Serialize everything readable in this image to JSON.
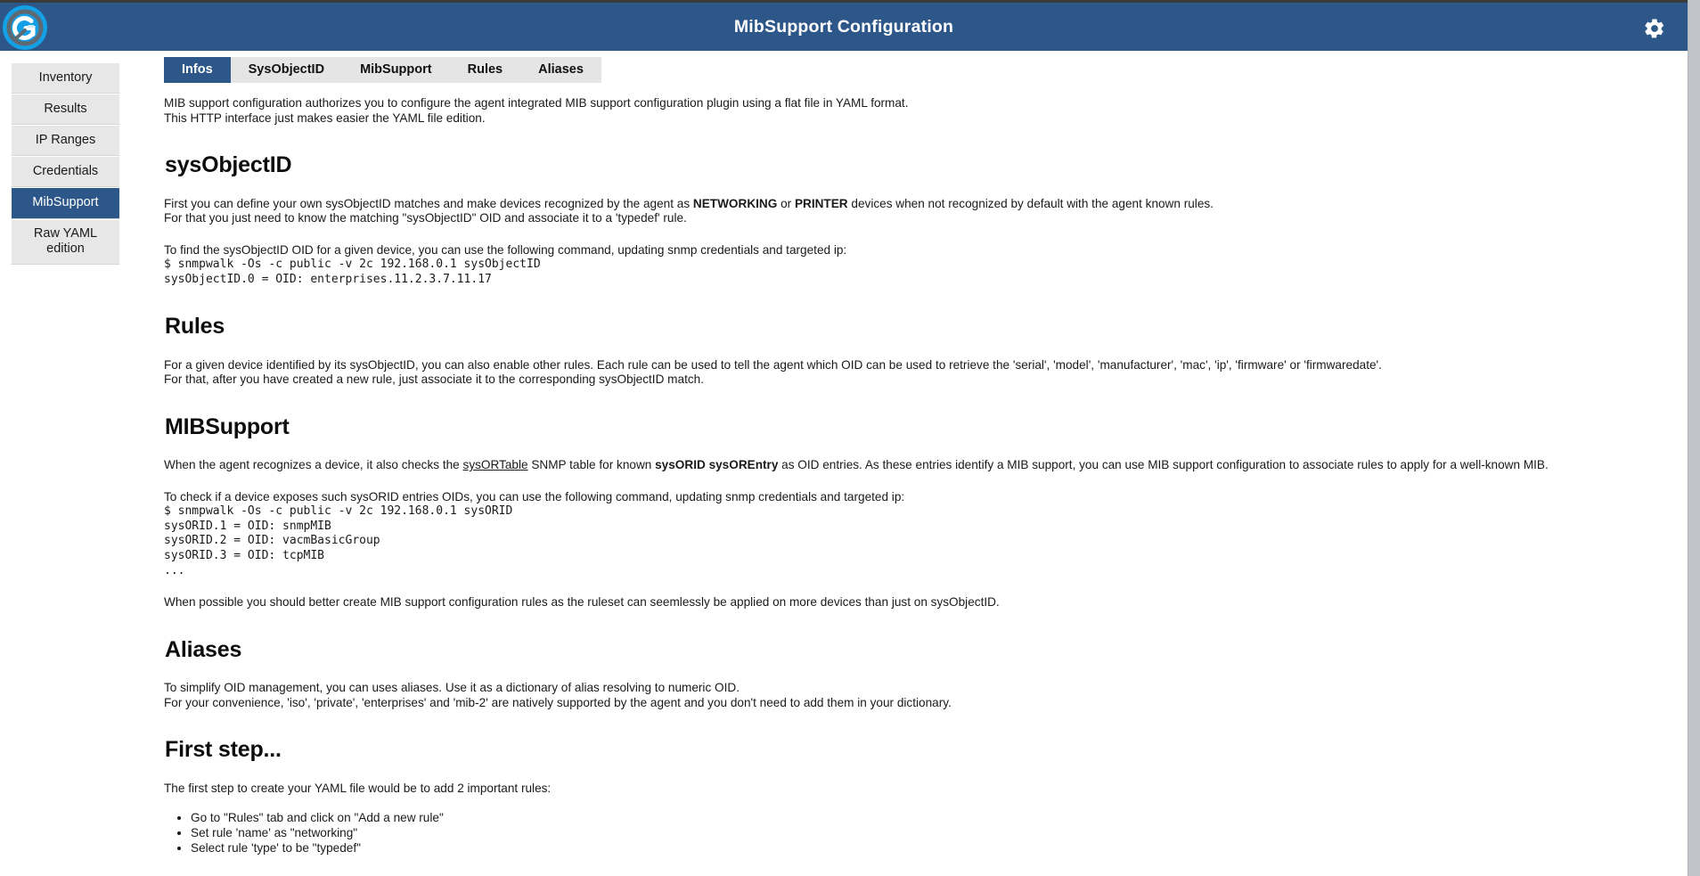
{
  "window": {
    "title": "MibSupport Configuration",
    "logo_icon": "glpi-agent-logo-icon",
    "settings_icon": "gear-icon",
    "header_bg": "#2e5789",
    "accent": "#2e5789"
  },
  "sidebar": {
    "items": [
      {
        "label": "Inventory",
        "active": false
      },
      {
        "label": "Results",
        "active": false
      },
      {
        "label": "IP Ranges",
        "active": false
      },
      {
        "label": "Credentials",
        "active": false
      },
      {
        "label": "MibSupport",
        "active": true
      },
      {
        "label": "Raw YAML edition",
        "active": false
      }
    ]
  },
  "tabs": [
    {
      "label": "Infos",
      "active": true
    },
    {
      "label": "SysObjectID",
      "active": false
    },
    {
      "label": "MibSupport",
      "active": false
    },
    {
      "label": "Rules",
      "active": false
    },
    {
      "label": "Aliases",
      "active": false
    }
  ],
  "main": {
    "intro_line1": "MIB support configuration authorizes you to configure the agent integrated MIB support configuration plugin using a flat file in YAML format.",
    "intro_line2": "This HTTP interface just makes easier the YAML file edition.",
    "sysobjectid": {
      "heading": "sysObjectID",
      "p1_a": "First you can define your own sysObjectID matches and make devices recognized by the agent as ",
      "p1_b1": "NETWORKING",
      "p1_mid": " or ",
      "p1_b2": "PRINTER",
      "p1_c": " devices when not recognized by default with the agent known rules.",
      "p2": "For that you just need to know the matching \"sysObjectID\" OID and associate it to a 'typedef' rule.",
      "cmd_intro": "To find the sysObjectID OID for a given device, you can use the following command, updating snmp credentials and targeted ip:",
      "cmd_line1": "$ snmpwalk -Os -c public -v 2c 192.168.0.1 sysObjectID",
      "cmd_line2": "sysObjectID.0 = OID: enterprises.11.2.3.7.11.17"
    },
    "rules": {
      "heading": "Rules",
      "p1": "For a given device identified by its sysObjectID, you can also enable other rules. Each rule can be used to tell the agent which OID can be used to retrieve the 'serial', 'model', 'manufacturer', 'mac', 'ip', 'firmware' or 'firmwaredate'.",
      "p2": "For that, after you have created a new rule, just associate it to the corresponding sysObjectID match."
    },
    "mibsupport": {
      "heading": "MIBSupport",
      "p1_a": "When the agent recognizes a device, it also checks the ",
      "p1_link": "sysORTable",
      "p1_b": " SNMP table for known ",
      "p1_bold": "sysORID sysOREntry",
      "p1_c": " as OID entries. As these entries identify a MIB support, you can use MIB support configuration to associate rules to apply for a well-known MIB.",
      "cmd_intro": "To check if a device exposes such sysORID entries OIDs, you can use the following command, updating snmp credentials and targeted ip:",
      "cmd_line1": "$ snmpwalk -Os -c public -v 2c 192.168.0.1 sysORID",
      "cmd_line2": "sysORID.1 = OID: snmpMIB",
      "cmd_line3": "sysORID.2 = OID: vacmBasicGroup",
      "cmd_line4": "sysORID.3 = OID: tcpMIB",
      "cmd_line5": "...",
      "p_after": "When possible you should better create MIB support configuration rules as the ruleset can seemlessly be applied on more devices than just on sysObjectID."
    },
    "aliases": {
      "heading": "Aliases",
      "p1": "To simplify OID management, you can uses aliases. Use it as a dictionary of alias resolving to numeric OID.",
      "p2": "For your convenience, 'iso', 'private', 'enterprises' and 'mib-2' are natively supported by the agent and you don't need to add them in your dictionary."
    },
    "firststep": {
      "heading": "First step...",
      "p1": "The first step to create your YAML file would be to add 2 important rules:",
      "steps": [
        "Go to \"Rules\" tab and click on \"Add a new rule\"",
        "Set rule 'name' as \"networking\"",
        "Select rule 'type' to be \"typedef\""
      ]
    }
  }
}
